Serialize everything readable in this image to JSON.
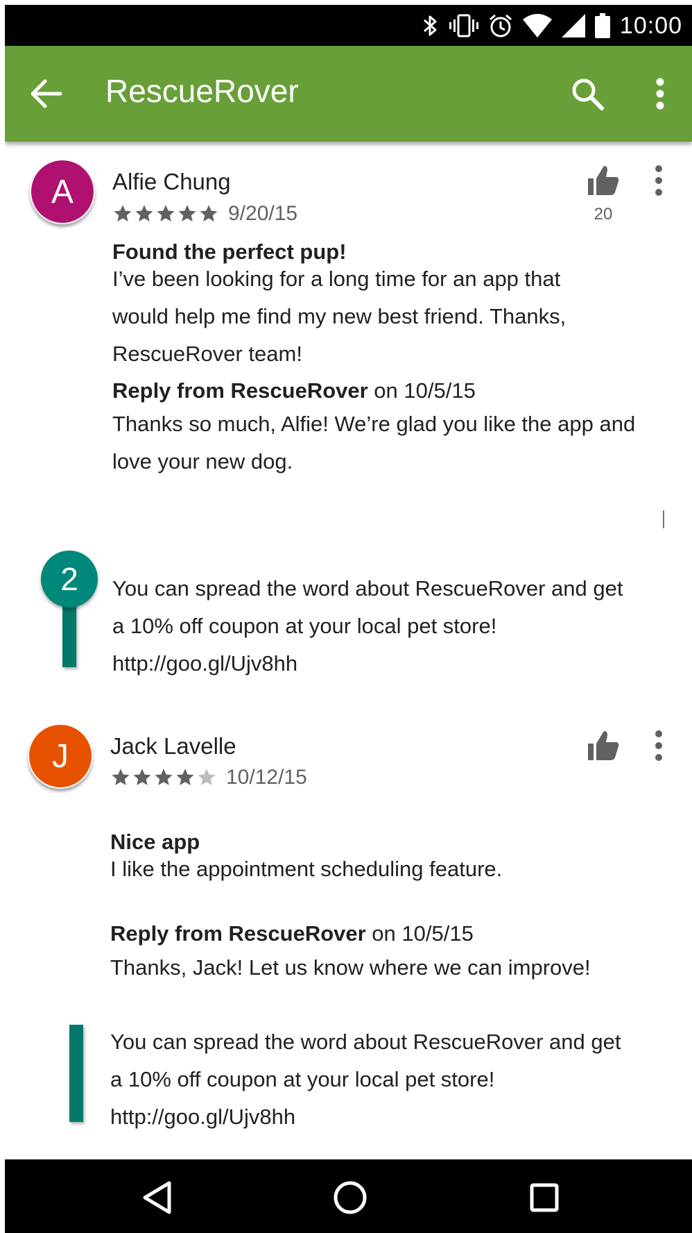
{
  "status_bar": {
    "time": "10:00"
  },
  "app_bar": {
    "title": "RescueRover"
  },
  "reviews": [
    {
      "avatar_letter": "A",
      "avatar_color": "#B0106F",
      "name": "Alfie Chung",
      "rating": 5,
      "date": "9/20/15",
      "likes": "20",
      "title": "Found the perfect pup!",
      "body": "I’ve been looking for a long time for an app that would help me find my new best friend. Thanks, RescueRover team!",
      "reply_from": "Reply from RescueRover",
      "reply_date": " on 10/5/15",
      "reply_body": "Thanks so much, Alfie! We’re glad you like the app and love your new dog.",
      "promo": "You can spread the word about RescueRover and get a 10% off coupon at your local pet store! http://goo.gl/Ujv8hh"
    },
    {
      "avatar_letter": "J",
      "avatar_color": "#E65100",
      "name": "Jack Lavelle",
      "rating": 4,
      "date": "10/12/15",
      "likes": "",
      "title": "Nice app",
      "body": "I like the appointment scheduling feature.",
      "reply_from": "Reply from RescueRover",
      "reply_date": " on 10/5/15",
      "reply_body": "Thanks, Jack! Let us know where we can improve!",
      "promo": "You can spread the word about RescueRover and get a 10% off coupon at your local pet store! http://goo.gl/Ujv8hh"
    }
  ],
  "marker": {
    "label": "2"
  },
  "colors": {
    "app_bar": "#689F38",
    "marker": "#00897B"
  },
  "icons": [
    "bluetooth-icon",
    "vibrate-icon",
    "alarm-icon",
    "wifi-icon",
    "signal-icon",
    "battery-icon",
    "back-arrow-icon",
    "search-icon",
    "more-vert-icon",
    "thumb-up-icon",
    "star-icon",
    "nav-back-icon",
    "nav-home-icon",
    "nav-recents-icon"
  ]
}
